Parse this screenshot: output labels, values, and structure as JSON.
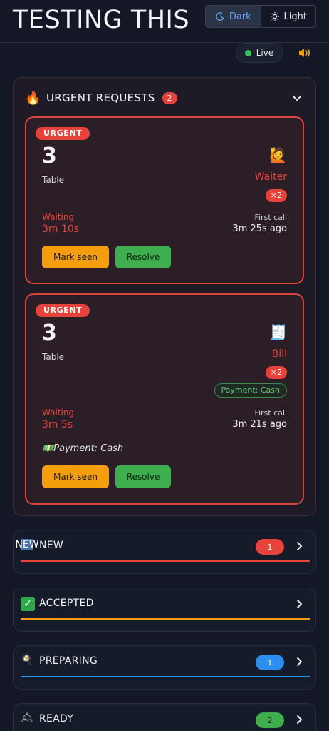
{
  "header": {
    "title": "TESTING THIS",
    "theme_dark_label": "Dark",
    "theme_light_label": "Light",
    "live_label": "Live"
  },
  "urgent": {
    "title": "URGENT REQUESTS",
    "count": "2",
    "cards": [
      {
        "tag": "URGENT",
        "table_number": "3",
        "table_label": "Table",
        "icon": "🙋",
        "type": "Waiter",
        "multiplier": "×2",
        "payment_chip": "",
        "waiting_label": "Waiting",
        "waiting_value": "3m 10s",
        "first_call_label": "First call",
        "first_call_value": "3m 25s ago",
        "payment_note": "",
        "mark_seen_label": "Mark seen",
        "resolve_label": "Resolve"
      },
      {
        "tag": "URGENT",
        "table_number": "3",
        "table_label": "Table",
        "icon": "🧾",
        "type": "Bill",
        "multiplier": "×2",
        "payment_chip": "Payment: Cash",
        "waiting_label": "Waiting",
        "waiting_value": "3m 5s",
        "first_call_label": "First call",
        "first_call_value": "3m 21s ago",
        "payment_note": "💵Payment: Cash",
        "mark_seen_label": "Mark seen",
        "resolve_label": "Resolve"
      }
    ]
  },
  "statuses": [
    {
      "label": "NEW",
      "icon": "NEW",
      "count": "1",
      "color": "#e5433b"
    },
    {
      "label": "ACCEPTED",
      "icon": "✓",
      "count": "",
      "color": "#f59e0b"
    },
    {
      "label": "PREPARING",
      "icon": "🍳",
      "count": "1",
      "color": "#2b8ff0"
    },
    {
      "label": "READY",
      "icon": "🛎",
      "count": "2",
      "color": "#3fae4f"
    }
  ],
  "colors": {
    "background": "#131726",
    "urgent": "#e5433b",
    "accent_blue": "#6aa9ff",
    "mark_seen": "#f59e0b",
    "resolve": "#3fae4f"
  }
}
